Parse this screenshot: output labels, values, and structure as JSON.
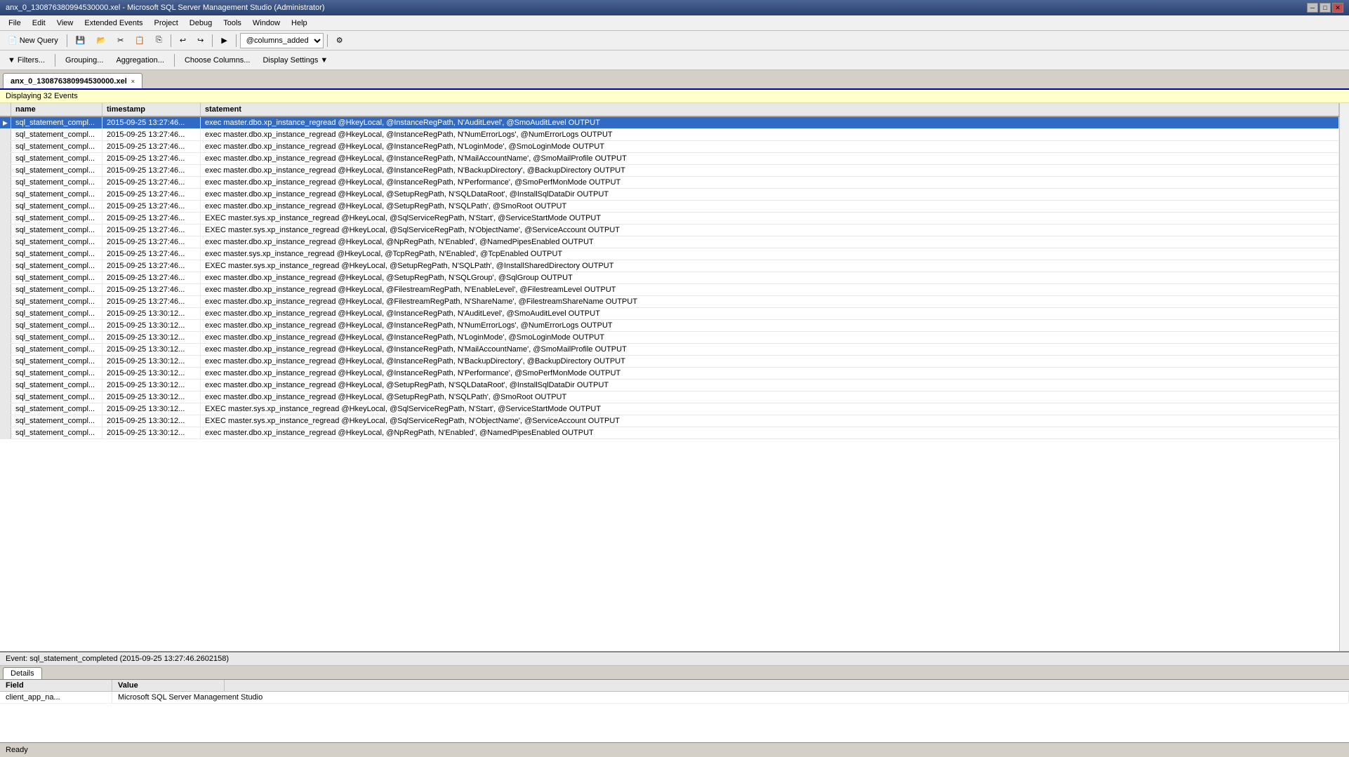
{
  "titleBar": {
    "text": "anx_0_130876380994530000.xel - Microsoft SQL Server Management Studio (Administrator)"
  },
  "menuBar": {
    "items": [
      "File",
      "Edit",
      "View",
      "Extended Events",
      "Project",
      "Debug",
      "Tools",
      "Window",
      "Help"
    ]
  },
  "toolbar1": {
    "newQueryLabel": "New Query",
    "dropdownValue": "@columns_added"
  },
  "toolbar2": {
    "filtersLabel": "Filters...",
    "groupingLabel": "Grouping...",
    "aggregationLabel": "Aggregation...",
    "chooseColumnsLabel": "Choose Columns...",
    "displaySettingsLabel": "Display Settings"
  },
  "tab": {
    "label": "anx_0_130876380994530000.xel",
    "closeLabel": "×"
  },
  "infoBar": {
    "text": "Displaying 32 Events"
  },
  "gridHeaders": [
    {
      "label": "",
      "class": "col-indicator"
    },
    {
      "label": "name",
      "class": "col-name"
    },
    {
      "label": "timestamp",
      "class": "col-timestamp"
    },
    {
      "label": "statement",
      "class": "col-statement"
    }
  ],
  "gridRows": [
    {
      "selected": true,
      "indicator": "▶",
      "name": "sql_statement_compl...",
      "timestamp": "2015-09-25 13:27:46...",
      "statement": "exec master.dbo.xp_instance_regread @HkeyLocal, @InstanceRegPath, N'AuditLevel', @SmoAuditLevel OUTPUT"
    },
    {
      "selected": false,
      "indicator": "",
      "name": "sql_statement_compl...",
      "timestamp": "2015-09-25 13:27:46...",
      "statement": "exec master.dbo.xp_instance_regread @HkeyLocal, @InstanceRegPath, N'NumErrorLogs', @NumErrorLogs OUTPUT"
    },
    {
      "selected": false,
      "indicator": "",
      "name": "sql_statement_compl...",
      "timestamp": "2015-09-25 13:27:46...",
      "statement": "exec master.dbo.xp_instance_regread @HkeyLocal, @InstanceRegPath, N'LoginMode', @SmoLoginMode OUTPUT"
    },
    {
      "selected": false,
      "indicator": "",
      "name": "sql_statement_compl...",
      "timestamp": "2015-09-25 13:27:46...",
      "statement": "exec master.dbo.xp_instance_regread @HkeyLocal, @InstanceRegPath, N'MailAccountName', @SmoMailProfile OUTPUT"
    },
    {
      "selected": false,
      "indicator": "",
      "name": "sql_statement_compl...",
      "timestamp": "2015-09-25 13:27:46...",
      "statement": "exec master.dbo.xp_instance_regread @HkeyLocal, @InstanceRegPath, N'BackupDirectory', @BackupDirectory OUTPUT"
    },
    {
      "selected": false,
      "indicator": "",
      "name": "sql_statement_compl...",
      "timestamp": "2015-09-25 13:27:46...",
      "statement": "exec master.dbo.xp_instance_regread @HkeyLocal, @InstanceRegPath, N'Performance', @SmoPerfMonMode OUTPUT"
    },
    {
      "selected": false,
      "indicator": "",
      "name": "sql_statement_compl...",
      "timestamp": "2015-09-25 13:27:46...",
      "statement": "exec master.dbo.xp_instance_regread @HkeyLocal, @SetupRegPath, N'SQLDataRoot', @InstallSqlDataDir OUTPUT"
    },
    {
      "selected": false,
      "indicator": "",
      "name": "sql_statement_compl...",
      "timestamp": "2015-09-25 13:27:46...",
      "statement": "exec master.dbo.xp_instance_regread @HkeyLocal, @SetupRegPath, N'SQLPath', @SmoRoot OUTPUT"
    },
    {
      "selected": false,
      "indicator": "",
      "name": "sql_statement_compl...",
      "timestamp": "2015-09-25 13:27:46...",
      "statement": "EXEC master.sys.xp_instance_regread @HkeyLocal, @SqlServiceRegPath, N'Start', @ServiceStartMode OUTPUT"
    },
    {
      "selected": false,
      "indicator": "",
      "name": "sql_statement_compl...",
      "timestamp": "2015-09-25 13:27:46...",
      "statement": "EXEC master.sys.xp_instance_regread @HkeyLocal, @SqlServiceRegPath, N'ObjectName', @ServiceAccount OUTPUT"
    },
    {
      "selected": false,
      "indicator": "",
      "name": "sql_statement_compl...",
      "timestamp": "2015-09-25 13:27:46...",
      "statement": "exec master.dbo.xp_instance_regread @HkeyLocal, @NpRegPath, N'Enabled', @NamedPipesEnabled OUTPUT"
    },
    {
      "selected": false,
      "indicator": "",
      "name": "sql_statement_compl...",
      "timestamp": "2015-09-25 13:27:46...",
      "statement": "exec master.sys.xp_instance_regread @HkeyLocal, @TcpRegPath, N'Enabled', @TcpEnabled OUTPUT"
    },
    {
      "selected": false,
      "indicator": "",
      "name": "sql_statement_compl...",
      "timestamp": "2015-09-25 13:27:46...",
      "statement": "EXEC master.sys.xp_instance_regread @HkeyLocal, @SetupRegPath, N'SQLPath', @InstallSharedDirectory OUTPUT"
    },
    {
      "selected": false,
      "indicator": "",
      "name": "sql_statement_compl...",
      "timestamp": "2015-09-25 13:27:46...",
      "statement": "exec master.dbo.xp_instance_regread @HkeyLocal, @SetupRegPath, N'SQLGroup', @SqlGroup OUTPUT"
    },
    {
      "selected": false,
      "indicator": "",
      "name": "sql_statement_compl...",
      "timestamp": "2015-09-25 13:27:46...",
      "statement": "exec master.dbo.xp_instance_regread @HkeyLocal, @FilestreamRegPath, N'EnableLevel', @FilestreamLevel OUTPUT"
    },
    {
      "selected": false,
      "indicator": "",
      "name": "sql_statement_compl...",
      "timestamp": "2015-09-25 13:27:46...",
      "statement": "exec master.dbo.xp_instance_regread @HkeyLocal, @FilestreamRegPath, N'ShareName', @FilestreamShareName OUTPUT"
    },
    {
      "selected": false,
      "indicator": "",
      "name": "sql_statement_compl...",
      "timestamp": "2015-09-25 13:30:12...",
      "statement": "exec master.dbo.xp_instance_regread @HkeyLocal, @InstanceRegPath, N'AuditLevel', @SmoAuditLevel OUTPUT"
    },
    {
      "selected": false,
      "indicator": "",
      "name": "sql_statement_compl...",
      "timestamp": "2015-09-25 13:30:12...",
      "statement": "exec master.dbo.xp_instance_regread @HkeyLocal, @InstanceRegPath, N'NumErrorLogs', @NumErrorLogs OUTPUT"
    },
    {
      "selected": false,
      "indicator": "",
      "name": "sql_statement_compl...",
      "timestamp": "2015-09-25 13:30:12...",
      "statement": "exec master.dbo.xp_instance_regread @HkeyLocal, @InstanceRegPath, N'LoginMode', @SmoLoginMode OUTPUT"
    },
    {
      "selected": false,
      "indicator": "",
      "name": "sql_statement_compl...",
      "timestamp": "2015-09-25 13:30:12...",
      "statement": "exec master.dbo.xp_instance_regread @HkeyLocal, @InstanceRegPath, N'MailAccountName', @SmoMailProfile OUTPUT"
    },
    {
      "selected": false,
      "indicator": "",
      "name": "sql_statement_compl...",
      "timestamp": "2015-09-25 13:30:12...",
      "statement": "exec master.dbo.xp_instance_regread @HkeyLocal, @InstanceRegPath, N'BackupDirectory', @BackupDirectory OUTPUT"
    },
    {
      "selected": false,
      "indicator": "",
      "name": "sql_statement_compl...",
      "timestamp": "2015-09-25 13:30:12...",
      "statement": "exec master.dbo.xp_instance_regread @HkeyLocal, @InstanceRegPath, N'Performance', @SmoPerfMonMode OUTPUT"
    },
    {
      "selected": false,
      "indicator": "",
      "name": "sql_statement_compl...",
      "timestamp": "2015-09-25 13:30:12...",
      "statement": "exec master.dbo.xp_instance_regread @HkeyLocal, @SetupRegPath, N'SQLDataRoot', @InstallSqlDataDir OUTPUT"
    },
    {
      "selected": false,
      "indicator": "",
      "name": "sql_statement_compl...",
      "timestamp": "2015-09-25 13:30:12...",
      "statement": "exec master.dbo.xp_instance_regread @HkeyLocal, @SetupRegPath, N'SQLPath', @SmoRoot OUTPUT"
    },
    {
      "selected": false,
      "indicator": "",
      "name": "sql_statement_compl...",
      "timestamp": "2015-09-25 13:30:12...",
      "statement": "EXEC master.sys.xp_instance_regread @HkeyLocal, @SqlServiceRegPath, N'Start', @ServiceStartMode OUTPUT"
    },
    {
      "selected": false,
      "indicator": "",
      "name": "sql_statement_compl...",
      "timestamp": "2015-09-25 13:30:12...",
      "statement": "EXEC master.sys.xp_instance_regread @HkeyLocal, @SqlServiceRegPath, N'ObjectName', @ServiceAccount OUTPUT"
    },
    {
      "selected": false,
      "indicator": "",
      "name": "sql_statement_compl...",
      "timestamp": "2015-09-25 13:30:12...",
      "statement": "exec master.dbo.xp_instance_regread @HkeyLocal, @NpRegPath, N'Enabled', @NamedPipesEnabled OUTPUT"
    }
  ],
  "eventBar": {
    "text": "Event: sql_statement_completed (2015-09-25 13:27:46.2602158)"
  },
  "detailsTabs": [
    {
      "label": "Details",
      "active": true
    }
  ],
  "detailsHeaders": [
    "Field",
    "Value"
  ],
  "detailsRows": [
    {
      "field": "client_app_na...",
      "value": "Microsoft SQL Server Management Studio"
    }
  ],
  "statusBar": {
    "text": "Ready"
  }
}
